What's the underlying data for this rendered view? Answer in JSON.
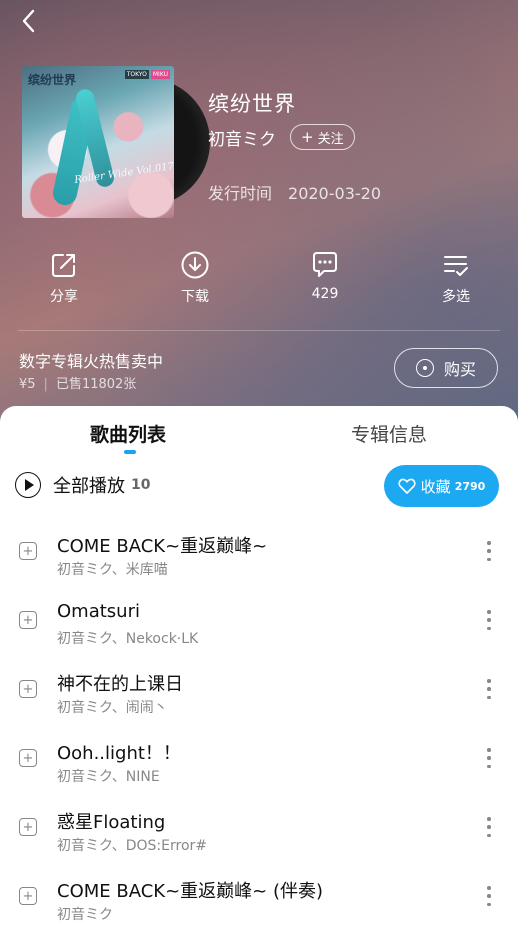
{
  "nav": {
    "back_icon": "chevron-left-icon"
  },
  "cover": {
    "title_art": "缤纷世界",
    "script_art": "Roller Wide Vol.017",
    "logo_left": "TOKYO",
    "logo_right": "MIKU"
  },
  "album": {
    "title": "缤纷世界",
    "artist": "初音ミク",
    "follow_label": "关注",
    "release_label": "发行时间",
    "release_date": "2020-03-20"
  },
  "actions": [
    {
      "icon": "share-icon",
      "label": "分享"
    },
    {
      "icon": "download-icon",
      "label": "下载"
    },
    {
      "icon": "comment-icon",
      "label": "429"
    },
    {
      "icon": "multi-select-icon",
      "label": "多选"
    }
  ],
  "promo": {
    "title": "数字专辑火热售卖中",
    "price": "¥5",
    "sold": "已售11802张",
    "buy_label": "购买"
  },
  "tabs": {
    "songs": "歌曲列表",
    "info": "专辑信息"
  },
  "playlist": {
    "play_all_label": "全部播放",
    "count": "10",
    "collect_label": "收藏",
    "collect_count": "2790"
  },
  "songs": [
    {
      "name": "COME BACK~重返巅峰~",
      "artist": "初音ミク、米库喵"
    },
    {
      "name": "Omatsuri",
      "artist": "初音ミク、Nekock·LK"
    },
    {
      "name": "神不在的上课日",
      "artist": "初音ミク、闹闹丶"
    },
    {
      "name": "Ooh..light！！",
      "artist": "初音ミク、NINE"
    },
    {
      "name": "惑星Floating",
      "artist": "初音ミク、DOS:Error#"
    },
    {
      "name": "COME BACK~重返巅峰~ (伴奏)",
      "artist": "初音ミク"
    }
  ],
  "colors": {
    "accent": "#1da8f2",
    "indicator": "#1aa4f0",
    "secondary_text": "#888888"
  }
}
